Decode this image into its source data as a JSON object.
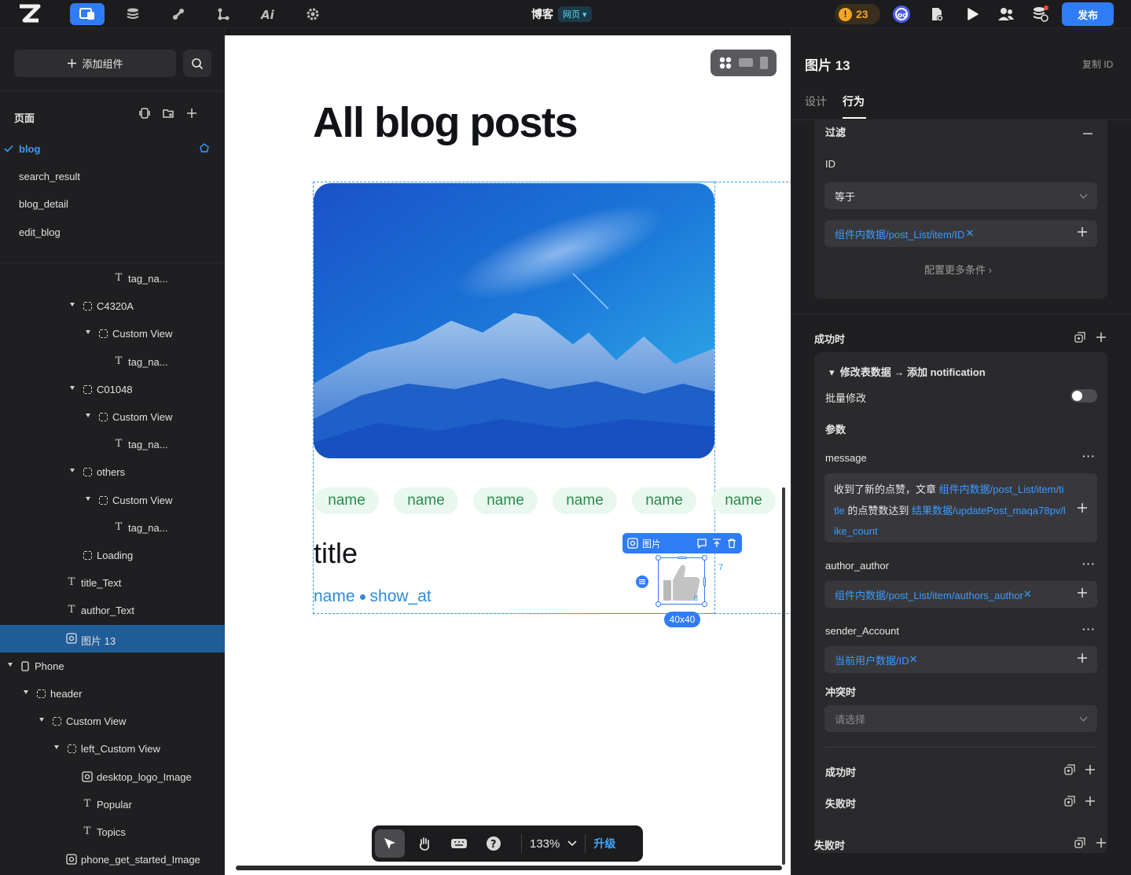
{
  "topbar": {
    "project_name": "博客",
    "project_type": "网页",
    "warning_count": "23",
    "publish_label": "发布",
    "accent": "#2f7cf6"
  },
  "left": {
    "add_component_label": "添加组件",
    "pages_title": "页面",
    "pages": [
      "blog",
      "search_result",
      "blog_detail",
      "edit_blog"
    ],
    "tree": [
      {
        "label": "tag_na...",
        "type": "text"
      },
      {
        "label": "C4320A",
        "type": "view"
      },
      {
        "label": "Custom View",
        "type": "view"
      },
      {
        "label": "tag_na...",
        "type": "text"
      },
      {
        "label": "C01048",
        "type": "view"
      },
      {
        "label": "Custom View",
        "type": "view"
      },
      {
        "label": "tag_na...",
        "type": "text"
      },
      {
        "label": "others",
        "type": "view"
      },
      {
        "label": "Custom View",
        "type": "view"
      },
      {
        "label": "tag_na...",
        "type": "text"
      },
      {
        "label": "Loading",
        "type": "view"
      },
      {
        "label": "title_Text",
        "type": "text"
      },
      {
        "label": "author_Text",
        "type": "text"
      },
      {
        "label": "图片 13",
        "type": "image"
      },
      {
        "label": "Phone",
        "type": "phone"
      },
      {
        "label": "header",
        "type": "view"
      },
      {
        "label": "Custom View",
        "type": "view"
      },
      {
        "label": "left_Custom View",
        "type": "view"
      },
      {
        "label": "desktop_logo_Image",
        "type": "image"
      },
      {
        "label": "Popular",
        "type": "text"
      },
      {
        "label": "Topics",
        "type": "text"
      },
      {
        "label": "phone_get_started_Image",
        "type": "image"
      }
    ]
  },
  "canvas": {
    "heading": "All blog posts",
    "tags": [
      "name",
      "name",
      "name",
      "name",
      "name",
      "name"
    ],
    "card_title": "title",
    "meta_name": "name",
    "meta_show_at": "show_at",
    "image_toolbar_label": "图片",
    "image_size": "40x40",
    "dim_right": "7",
    "dim_bottom": "8",
    "zoom": "133%",
    "upgrade_label": "升级"
  },
  "right": {
    "title": "图片 13",
    "copy_id_label": "复制 ID",
    "tabs": [
      "设计",
      "行为"
    ],
    "active_tab": "行为",
    "filter": {
      "title": "过滤",
      "id_label": "ID",
      "operator": "等于",
      "value": "组件内数据/post_List/item/ID",
      "more_conditions": "配置更多条件"
    },
    "on_success_label": "成功时",
    "action": {
      "title": "修改表数据 → 添加 notification",
      "batch_label": "批量修改",
      "params_label": "参数",
      "message_label": "message",
      "message_prefix": "收到了新的点赞，文章 ",
      "message_ref1": "组件内数据/post_List/item/title",
      "message_mid": " 的点赞数达到 ",
      "message_ref2": "结果数据/updatePost_maqa78pv/like_count",
      "author_label": "author_author",
      "author_value": "组件内数据/post_List/item/authors_author",
      "sender_label": "sender_Account",
      "sender_value": "当前用户数据/ID",
      "conflict_label": "冲突时",
      "conflict_placeholder": "请选择",
      "inner_success_label": "成功时",
      "inner_fail_label": "失败时"
    },
    "on_fail_label": "失败时"
  }
}
